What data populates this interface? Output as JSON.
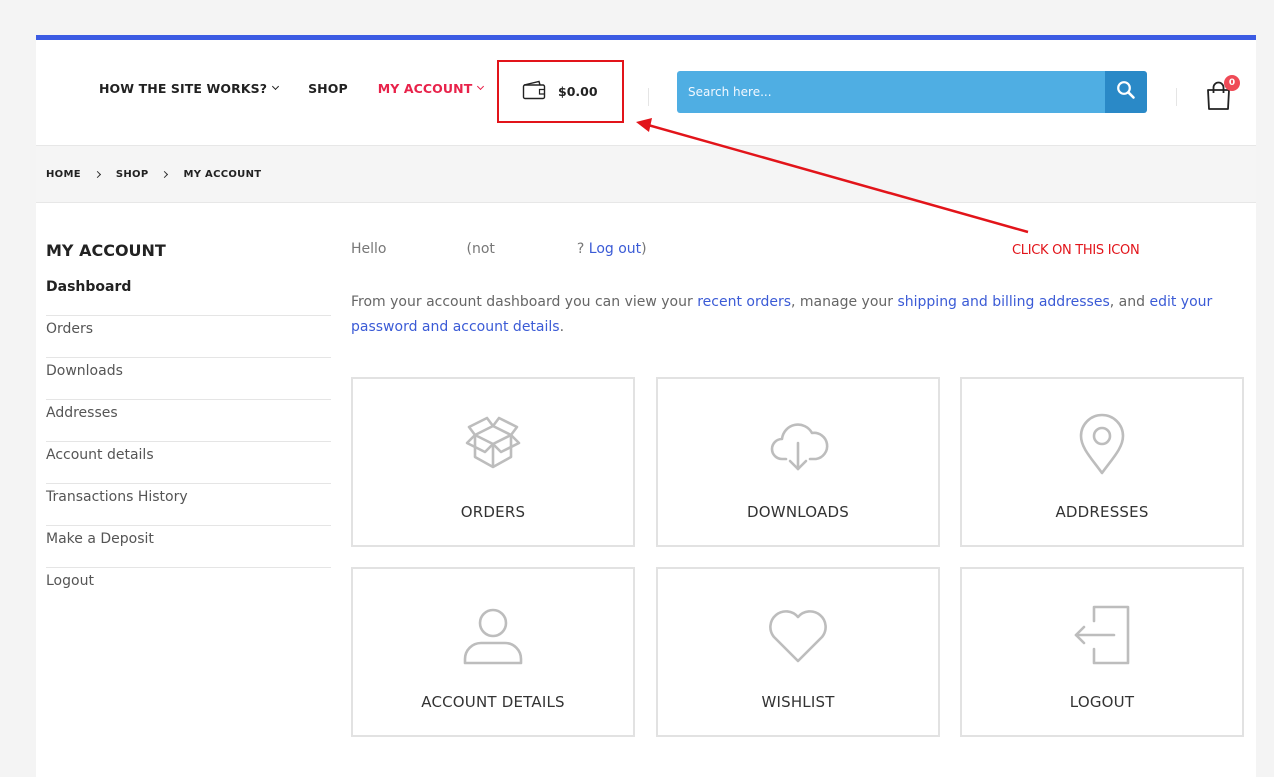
{
  "header": {
    "nav": [
      {
        "label": "HOW THE SITE WORKS?"
      },
      {
        "label": "SHOP"
      },
      {
        "label": "MY ACCOUNT"
      }
    ],
    "wallet_amount": "$0.00",
    "search_placeholder": "Search here...",
    "cart_count": "0"
  },
  "breadcrumb": [
    "HOME",
    "SHOP",
    "MY ACCOUNT"
  ],
  "sidebar": {
    "title": "MY ACCOUNT",
    "items": [
      {
        "label": "Dashboard"
      },
      {
        "label": "Orders"
      },
      {
        "label": "Downloads"
      },
      {
        "label": "Addresses"
      },
      {
        "label": "Account details"
      },
      {
        "label": "Transactions History"
      },
      {
        "label": "Make a Deposit"
      },
      {
        "label": "Logout"
      }
    ]
  },
  "main": {
    "hello_prefix": "Hello",
    "hello_not": "(not",
    "hello_q": "?",
    "logout_link": "Log out",
    "hello_close": ")",
    "intro_1": "From your account dashboard you can view your ",
    "intro_link_1": "recent orders",
    "intro_2": ", manage your ",
    "intro_link_2": "shipping and billing addresses",
    "intro_3": ", and ",
    "intro_link_3": "edit your password and account details",
    "intro_4": ".",
    "cards": [
      {
        "label": "ORDERS",
        "icon": "box-icon"
      },
      {
        "label": "DOWNLOADS",
        "icon": "cloud-download-icon"
      },
      {
        "label": "ADDRESSES",
        "icon": "map-pin-icon"
      },
      {
        "label": "ACCOUNT DETAILS",
        "icon": "user-icon"
      },
      {
        "label": "WISHLIST",
        "icon": "heart-icon"
      },
      {
        "label": "LOGOUT",
        "icon": "logout-icon"
      }
    ]
  },
  "annotation": "CLICK ON THIS ICON",
  "colors": {
    "accent_bar": "#3b5be3",
    "active_nav": "#e8224a",
    "search_bg": "#4faee3",
    "search_btn": "#2a89c7",
    "annotation": "#e2141a",
    "link": "#3b5bd6"
  }
}
